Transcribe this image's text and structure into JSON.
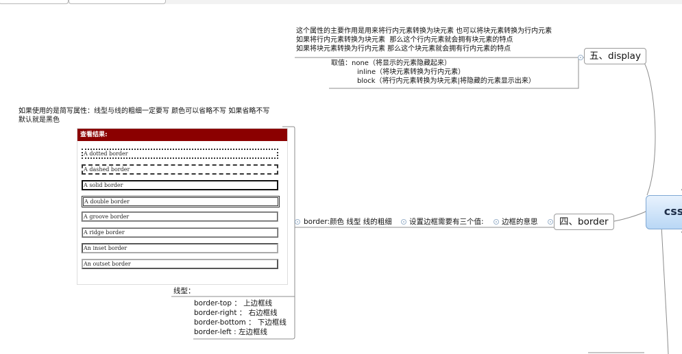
{
  "root": {
    "label": "css"
  },
  "display": {
    "label": "五、display",
    "desc_lines": [
      "这个属性的主要作用是用来将行内元素转换为块元素 也可以将块元素转换为行内元素",
      "如果将行内元素转换为块元素  那么这个行内元素就会拥有块元素的特点",
      "如果将块元素转换为行内元素 那么这个块元素就会拥有行内元素的特点"
    ],
    "values_lines": [
      "取值：none（将显示的元素隐藏起来）",
      "inline（将块元素转换为行内元素）",
      "block（将行内元素转换为块元素|将隐藏的元素显示出来）"
    ]
  },
  "border": {
    "label": "四、border",
    "meaning": "边框的意思",
    "three_values": "设置边框需要有三个值:",
    "syntax": "border:颜色 线型 线的粗细",
    "shorthand_note": [
      "如果使用的是简写属性：线型与线的粗细一定要写 颜色可以省略不写 如果省略不写",
      "默认就是黑色"
    ],
    "line_type_label": "线型：",
    "sides": [
      "border-top  ：  上边框线",
      "border-right ：  右边框线",
      "border-bottom ：  下边框线",
      "border-left : 左边框线"
    ],
    "demo": {
      "header": "查看结果:",
      "styles": [
        "A dotted border",
        "A dashed border",
        "A solid border",
        "A double border",
        "A groove border",
        "A ridge border",
        "An inset border",
        "An outset border"
      ]
    }
  }
}
